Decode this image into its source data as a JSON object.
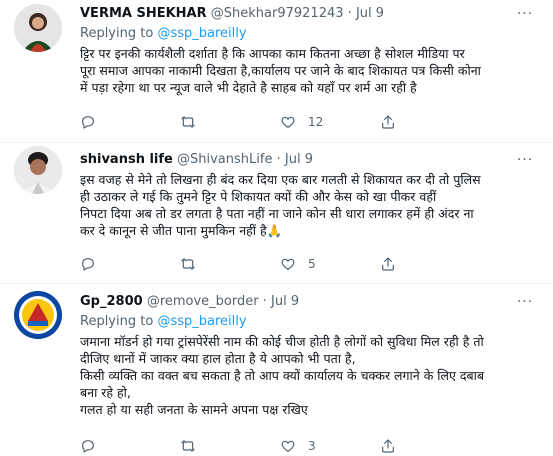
{
  "tweets": [
    {
      "name": "VERMA SHEKHAR",
      "handle": "@Shekhar97921243",
      "dot": "·",
      "date": "Jul 9",
      "more": "···",
      "replying_prefix": "Replying to ",
      "replying_to": "@ssp_bareilly",
      "text": "ट्टिर पर इनकी कार्यशैली दर्शाता है कि आपका काम कितना अच्छा है सोशल मीडिया पर\nपूरा समाज आपका नाकामी दिखता है,कार्यालय पर जाने के बाद शिकायत पत्र किसी कोना\nमें पड़ा रहेगा था पर न्यूज वाले भी देहाते है साहब को यहाँ पर शर्म आ रही है",
      "replies": "",
      "retweets": "",
      "likes": "12"
    },
    {
      "name": "shivansh life",
      "handle": "@ShivanshLife",
      "dot": "·",
      "date": "Jul 9",
      "more": "···",
      "replying_prefix": "",
      "replying_to": "",
      "text": "इस वजह से मेने तो लिखना ही बंद कर दिया एक बार गलती से शिकायत कर दी तो पुलिस\nही उठाकर ले गई कि तुमने ट्टिर पे शिकायत क्यों की और केस को खा पीकर वहीं\nनिपटा दिया अब तो डर लगता है पता नहीं ना जाने कोन सी धारा लगाकर हमें ही अंदर ना\nकर दे कानून से जीत पाना मुमकिन नहीं है🙏",
      "replies": "",
      "retweets": "",
      "likes": "5"
    },
    {
      "name": "Gp_2800",
      "handle": "@remove_border",
      "dot": "·",
      "date": "Jul 9",
      "more": "···",
      "replying_prefix": "Replying to ",
      "replying_to": "@ssp_bareilly",
      "text": "जमाना मॉडर्न हो गया ट्रांसपेरेंसी नाम की कोई चीज होती है लोगों को सुविधा मिल रही है तो\nदीजिए थानों में जाकर क्या हाल होता है ये आपको भी पता है,\nकिसी व्यक्ति का वक्त बच सकता है तो आप क्यों कार्यालय के चक्कर लगाने के लिए दबाब\nबना रहे हो,\nगलत हो या सही जनता के सामने अपना पक्ष रखिए",
      "replies": "",
      "retweets": "",
      "likes": "3"
    }
  ]
}
